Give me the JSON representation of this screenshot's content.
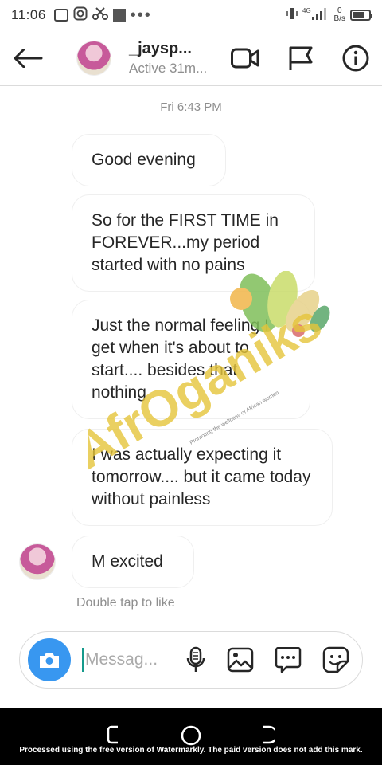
{
  "status_bar": {
    "time": "11:06",
    "network": "4G",
    "net_speed_value": "0",
    "net_speed_unit": "B/s"
  },
  "header": {
    "username": "_jaysp...",
    "status": "Active 31m..."
  },
  "chat": {
    "timestamp": "Fri 6:43 PM",
    "messages": [
      {
        "text": "Good evening"
      },
      {
        "text": "So for the FIRST TIME in FOREVER...my period started with no pains"
      },
      {
        "text": "Just the normal feeling I get when it's about to start.... besides that nothing"
      },
      {
        "text": "I was actually expecting it tomorrow.... but it came today without painless"
      },
      {
        "text": "M excited"
      }
    ],
    "like_hint": "Double tap to like"
  },
  "watermark": {
    "brand": "AfrOganiks",
    "tagline": "Promoting the wellness of African women"
  },
  "composer": {
    "placeholder": "Messag..."
  },
  "footer": {
    "watermark_notice": "Processed using the free version of Watermarkly. The paid version does not add this mark."
  },
  "colors": {
    "accent": "#3897f0",
    "bubble_border": "#efefef",
    "muted_text": "#8e8e8e"
  }
}
